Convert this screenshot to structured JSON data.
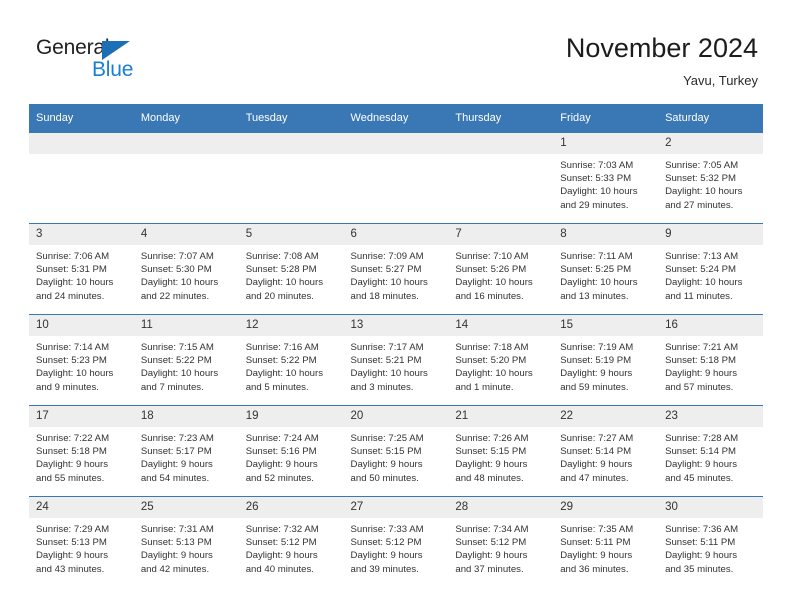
{
  "brand": {
    "name_part1": "General",
    "name_part2": "Blue",
    "triangle_color": "#1a6fb5",
    "blue_color": "#1a7fd4"
  },
  "header": {
    "title": "November 2024",
    "subtitle": "Yavu, Turkey",
    "accent_color": "#3a77b5"
  },
  "weekdays": [
    "Sunday",
    "Monday",
    "Tuesday",
    "Wednesday",
    "Thursday",
    "Friday",
    "Saturday"
  ],
  "weeks": [
    [
      {
        "day": "",
        "sunrise": "",
        "sunset": "",
        "daylight": ""
      },
      {
        "day": "",
        "sunrise": "",
        "sunset": "",
        "daylight": ""
      },
      {
        "day": "",
        "sunrise": "",
        "sunset": "",
        "daylight": ""
      },
      {
        "day": "",
        "sunrise": "",
        "sunset": "",
        "daylight": ""
      },
      {
        "day": "",
        "sunrise": "",
        "sunset": "",
        "daylight": ""
      },
      {
        "day": "1",
        "sunrise": "Sunrise: 7:03 AM",
        "sunset": "Sunset: 5:33 PM",
        "daylight": "Daylight: 10 hours and 29 minutes."
      },
      {
        "day": "2",
        "sunrise": "Sunrise: 7:05 AM",
        "sunset": "Sunset: 5:32 PM",
        "daylight": "Daylight: 10 hours and 27 minutes."
      }
    ],
    [
      {
        "day": "3",
        "sunrise": "Sunrise: 7:06 AM",
        "sunset": "Sunset: 5:31 PM",
        "daylight": "Daylight: 10 hours and 24 minutes."
      },
      {
        "day": "4",
        "sunrise": "Sunrise: 7:07 AM",
        "sunset": "Sunset: 5:30 PM",
        "daylight": "Daylight: 10 hours and 22 minutes."
      },
      {
        "day": "5",
        "sunrise": "Sunrise: 7:08 AM",
        "sunset": "Sunset: 5:28 PM",
        "daylight": "Daylight: 10 hours and 20 minutes."
      },
      {
        "day": "6",
        "sunrise": "Sunrise: 7:09 AM",
        "sunset": "Sunset: 5:27 PM",
        "daylight": "Daylight: 10 hours and 18 minutes."
      },
      {
        "day": "7",
        "sunrise": "Sunrise: 7:10 AM",
        "sunset": "Sunset: 5:26 PM",
        "daylight": "Daylight: 10 hours and 16 minutes."
      },
      {
        "day": "8",
        "sunrise": "Sunrise: 7:11 AM",
        "sunset": "Sunset: 5:25 PM",
        "daylight": "Daylight: 10 hours and 13 minutes."
      },
      {
        "day": "9",
        "sunrise": "Sunrise: 7:13 AM",
        "sunset": "Sunset: 5:24 PM",
        "daylight": "Daylight: 10 hours and 11 minutes."
      }
    ],
    [
      {
        "day": "10",
        "sunrise": "Sunrise: 7:14 AM",
        "sunset": "Sunset: 5:23 PM",
        "daylight": "Daylight: 10 hours and 9 minutes."
      },
      {
        "day": "11",
        "sunrise": "Sunrise: 7:15 AM",
        "sunset": "Sunset: 5:22 PM",
        "daylight": "Daylight: 10 hours and 7 minutes."
      },
      {
        "day": "12",
        "sunrise": "Sunrise: 7:16 AM",
        "sunset": "Sunset: 5:22 PM",
        "daylight": "Daylight: 10 hours and 5 minutes."
      },
      {
        "day": "13",
        "sunrise": "Sunrise: 7:17 AM",
        "sunset": "Sunset: 5:21 PM",
        "daylight": "Daylight: 10 hours and 3 minutes."
      },
      {
        "day": "14",
        "sunrise": "Sunrise: 7:18 AM",
        "sunset": "Sunset: 5:20 PM",
        "daylight": "Daylight: 10 hours and 1 minute."
      },
      {
        "day": "15",
        "sunrise": "Sunrise: 7:19 AM",
        "sunset": "Sunset: 5:19 PM",
        "daylight": "Daylight: 9 hours and 59 minutes."
      },
      {
        "day": "16",
        "sunrise": "Sunrise: 7:21 AM",
        "sunset": "Sunset: 5:18 PM",
        "daylight": "Daylight: 9 hours and 57 minutes."
      }
    ],
    [
      {
        "day": "17",
        "sunrise": "Sunrise: 7:22 AM",
        "sunset": "Sunset: 5:18 PM",
        "daylight": "Daylight: 9 hours and 55 minutes."
      },
      {
        "day": "18",
        "sunrise": "Sunrise: 7:23 AM",
        "sunset": "Sunset: 5:17 PM",
        "daylight": "Daylight: 9 hours and 54 minutes."
      },
      {
        "day": "19",
        "sunrise": "Sunrise: 7:24 AM",
        "sunset": "Sunset: 5:16 PM",
        "daylight": "Daylight: 9 hours and 52 minutes."
      },
      {
        "day": "20",
        "sunrise": "Sunrise: 7:25 AM",
        "sunset": "Sunset: 5:15 PM",
        "daylight": "Daylight: 9 hours and 50 minutes."
      },
      {
        "day": "21",
        "sunrise": "Sunrise: 7:26 AM",
        "sunset": "Sunset: 5:15 PM",
        "daylight": "Daylight: 9 hours and 48 minutes."
      },
      {
        "day": "22",
        "sunrise": "Sunrise: 7:27 AM",
        "sunset": "Sunset: 5:14 PM",
        "daylight": "Daylight: 9 hours and 47 minutes."
      },
      {
        "day": "23",
        "sunrise": "Sunrise: 7:28 AM",
        "sunset": "Sunset: 5:14 PM",
        "daylight": "Daylight: 9 hours and 45 minutes."
      }
    ],
    [
      {
        "day": "24",
        "sunrise": "Sunrise: 7:29 AM",
        "sunset": "Sunset: 5:13 PM",
        "daylight": "Daylight: 9 hours and 43 minutes."
      },
      {
        "day": "25",
        "sunrise": "Sunrise: 7:31 AM",
        "sunset": "Sunset: 5:13 PM",
        "daylight": "Daylight: 9 hours and 42 minutes."
      },
      {
        "day": "26",
        "sunrise": "Sunrise: 7:32 AM",
        "sunset": "Sunset: 5:12 PM",
        "daylight": "Daylight: 9 hours and 40 minutes."
      },
      {
        "day": "27",
        "sunrise": "Sunrise: 7:33 AM",
        "sunset": "Sunset: 5:12 PM",
        "daylight": "Daylight: 9 hours and 39 minutes."
      },
      {
        "day": "28",
        "sunrise": "Sunrise: 7:34 AM",
        "sunset": "Sunset: 5:12 PM",
        "daylight": "Daylight: 9 hours and 37 minutes."
      },
      {
        "day": "29",
        "sunrise": "Sunrise: 7:35 AM",
        "sunset": "Sunset: 5:11 PM",
        "daylight": "Daylight: 9 hours and 36 minutes."
      },
      {
        "day": "30",
        "sunrise": "Sunrise: 7:36 AM",
        "sunset": "Sunset: 5:11 PM",
        "daylight": "Daylight: 9 hours and 35 minutes."
      }
    ]
  ]
}
